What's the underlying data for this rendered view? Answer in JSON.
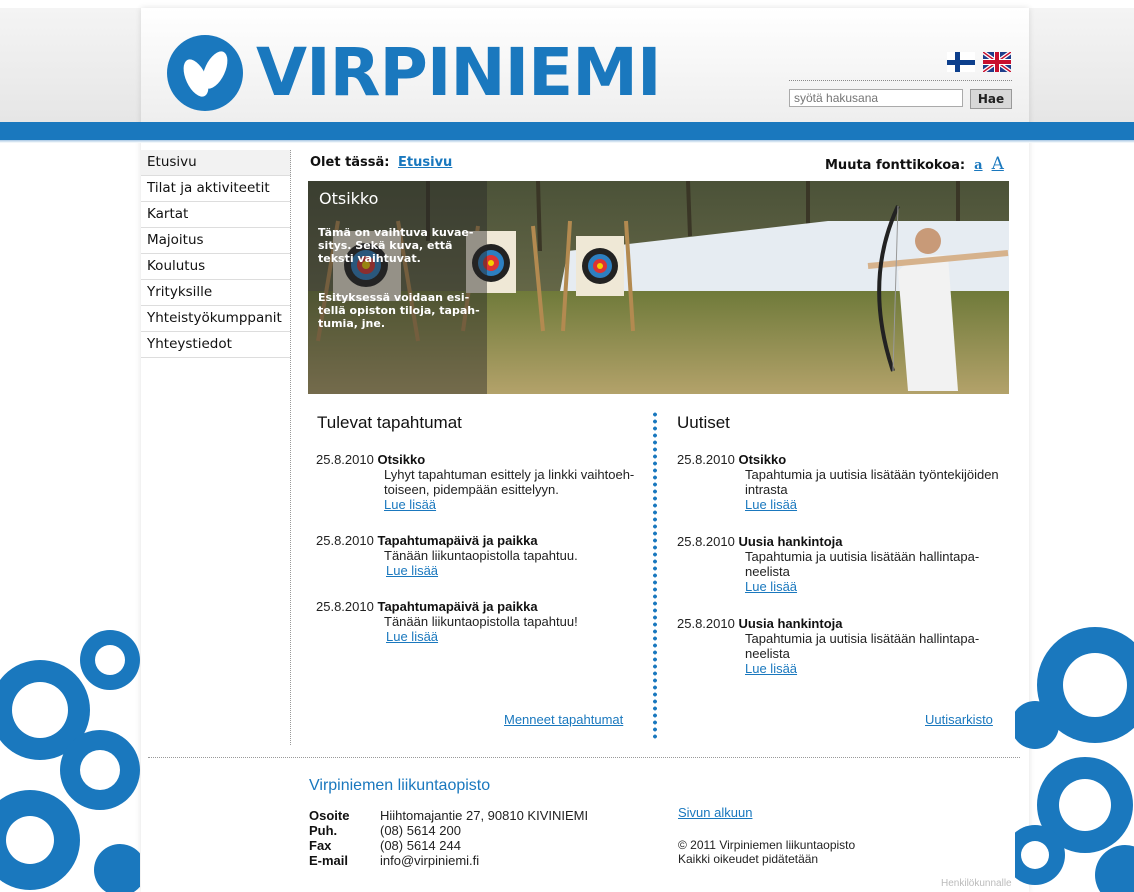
{
  "header": {
    "logo_text": "VIRPINIEMI",
    "search_placeholder": "syötä hakusana",
    "search_button": "Hae",
    "flags": [
      "finnish-flag",
      "uk-flag"
    ]
  },
  "nav": {
    "items": [
      "Etusivu",
      "Tilat ja aktiviteetit",
      "Kartat",
      "Majoitus",
      "Koulutus",
      "Yrityksille",
      "Yhteistyökumppanit",
      "Yhteystiedot"
    ]
  },
  "breadcrumb": {
    "label": "Olet tässä:",
    "link": "Etusivu"
  },
  "fontsize": {
    "label": "Muuta fonttikokoa:",
    "small": "a",
    "large": "A"
  },
  "hero": {
    "title": "Otsikko",
    "text1": "Tämä on vaihtuva kuvae-sitys. Sekä kuva, että teksti vaihtuvat.",
    "text2": "Esityksessä voidaan esi-tellä opiston tiloja, tapah-tumia, jne."
  },
  "events": {
    "title": "Tulevat tapahtumat",
    "items": [
      {
        "date": "25.8.2010",
        "title": "Otsikko",
        "body": "Lyhyt tapahtuman esittely ja linkki vaihtoeh-toiseen, pidempään esittelyyn.",
        "link": "Lue lisää"
      },
      {
        "date": "25.8.2010",
        "title": "Tapahtumapäivä ja paikka",
        "body": "Tänään liikuntaopistolla tapahtuu.",
        "link": "Lue lisää"
      },
      {
        "date": "25.8.2010",
        "title": "Tapahtumapäivä ja paikka",
        "body": "Tänään liikuntaopistolla tapahtuu!",
        "link": "Lue lisää"
      }
    ],
    "more": "Menneet tapahtumat"
  },
  "news": {
    "title": "Uutiset",
    "items": [
      {
        "date": "25.8.2010",
        "title": "Otsikko",
        "body": "Tapahtumia ja uutisia lisätään työntekijöiden intrasta",
        "link": "Lue lisää"
      },
      {
        "date": "25.8.2010",
        "title": "Uusia hankintoja",
        "body": "Tapahtumia ja uutisia lisätään hallintapa-neelista",
        "link": "Lue lisää"
      },
      {
        "date": "25.8.2010",
        "title": "Uusia hankintoja",
        "body": "Tapahtumia ja uutisia lisätään hallintapa-neelista",
        "link": "Lue lisää"
      }
    ],
    "more": "Uutisarkisto"
  },
  "footer": {
    "org": "Virpiniemen liikuntaopisto",
    "contact": [
      {
        "k": "Osoite",
        "v": "Hiihtomajantie 27, 90810 KIVINIEMI"
      },
      {
        "k": "Puh.",
        "v": "(08) 5614 200"
      },
      {
        "k": "Fax",
        "v": "(08) 5614 244"
      },
      {
        "k": "E-mail",
        "v": "info@virpiniemi.fi"
      }
    ],
    "top_link": "Sivun alkuun",
    "copyright1": "© 2011 Virpiniemen liikuntaopisto",
    "copyright2": "Kaikki oikeudet pidätetään",
    "staff_link": "Henkilökunnalle"
  },
  "colors": {
    "brand": "#1a78be"
  }
}
